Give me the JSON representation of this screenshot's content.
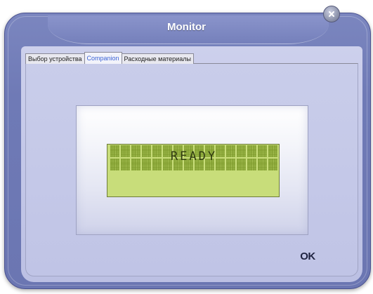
{
  "window": {
    "title": "Monitor"
  },
  "tabs": [
    {
      "label": "Выбор устройства",
      "active": false
    },
    {
      "label": "Companion",
      "active": true
    },
    {
      "label": "Расходные материалы",
      "active": false
    }
  ],
  "lcd": {
    "status_text": "READY",
    "background_color": "#c8dd7a",
    "columns": 16,
    "rows": 2
  },
  "buttons": {
    "ok_label": "OK",
    "close_icon": "close-x-icon"
  },
  "colors": {
    "frame": "#6f7ab6",
    "panel": "#c3c7e8",
    "active_tab_text": "#3c63d6"
  }
}
